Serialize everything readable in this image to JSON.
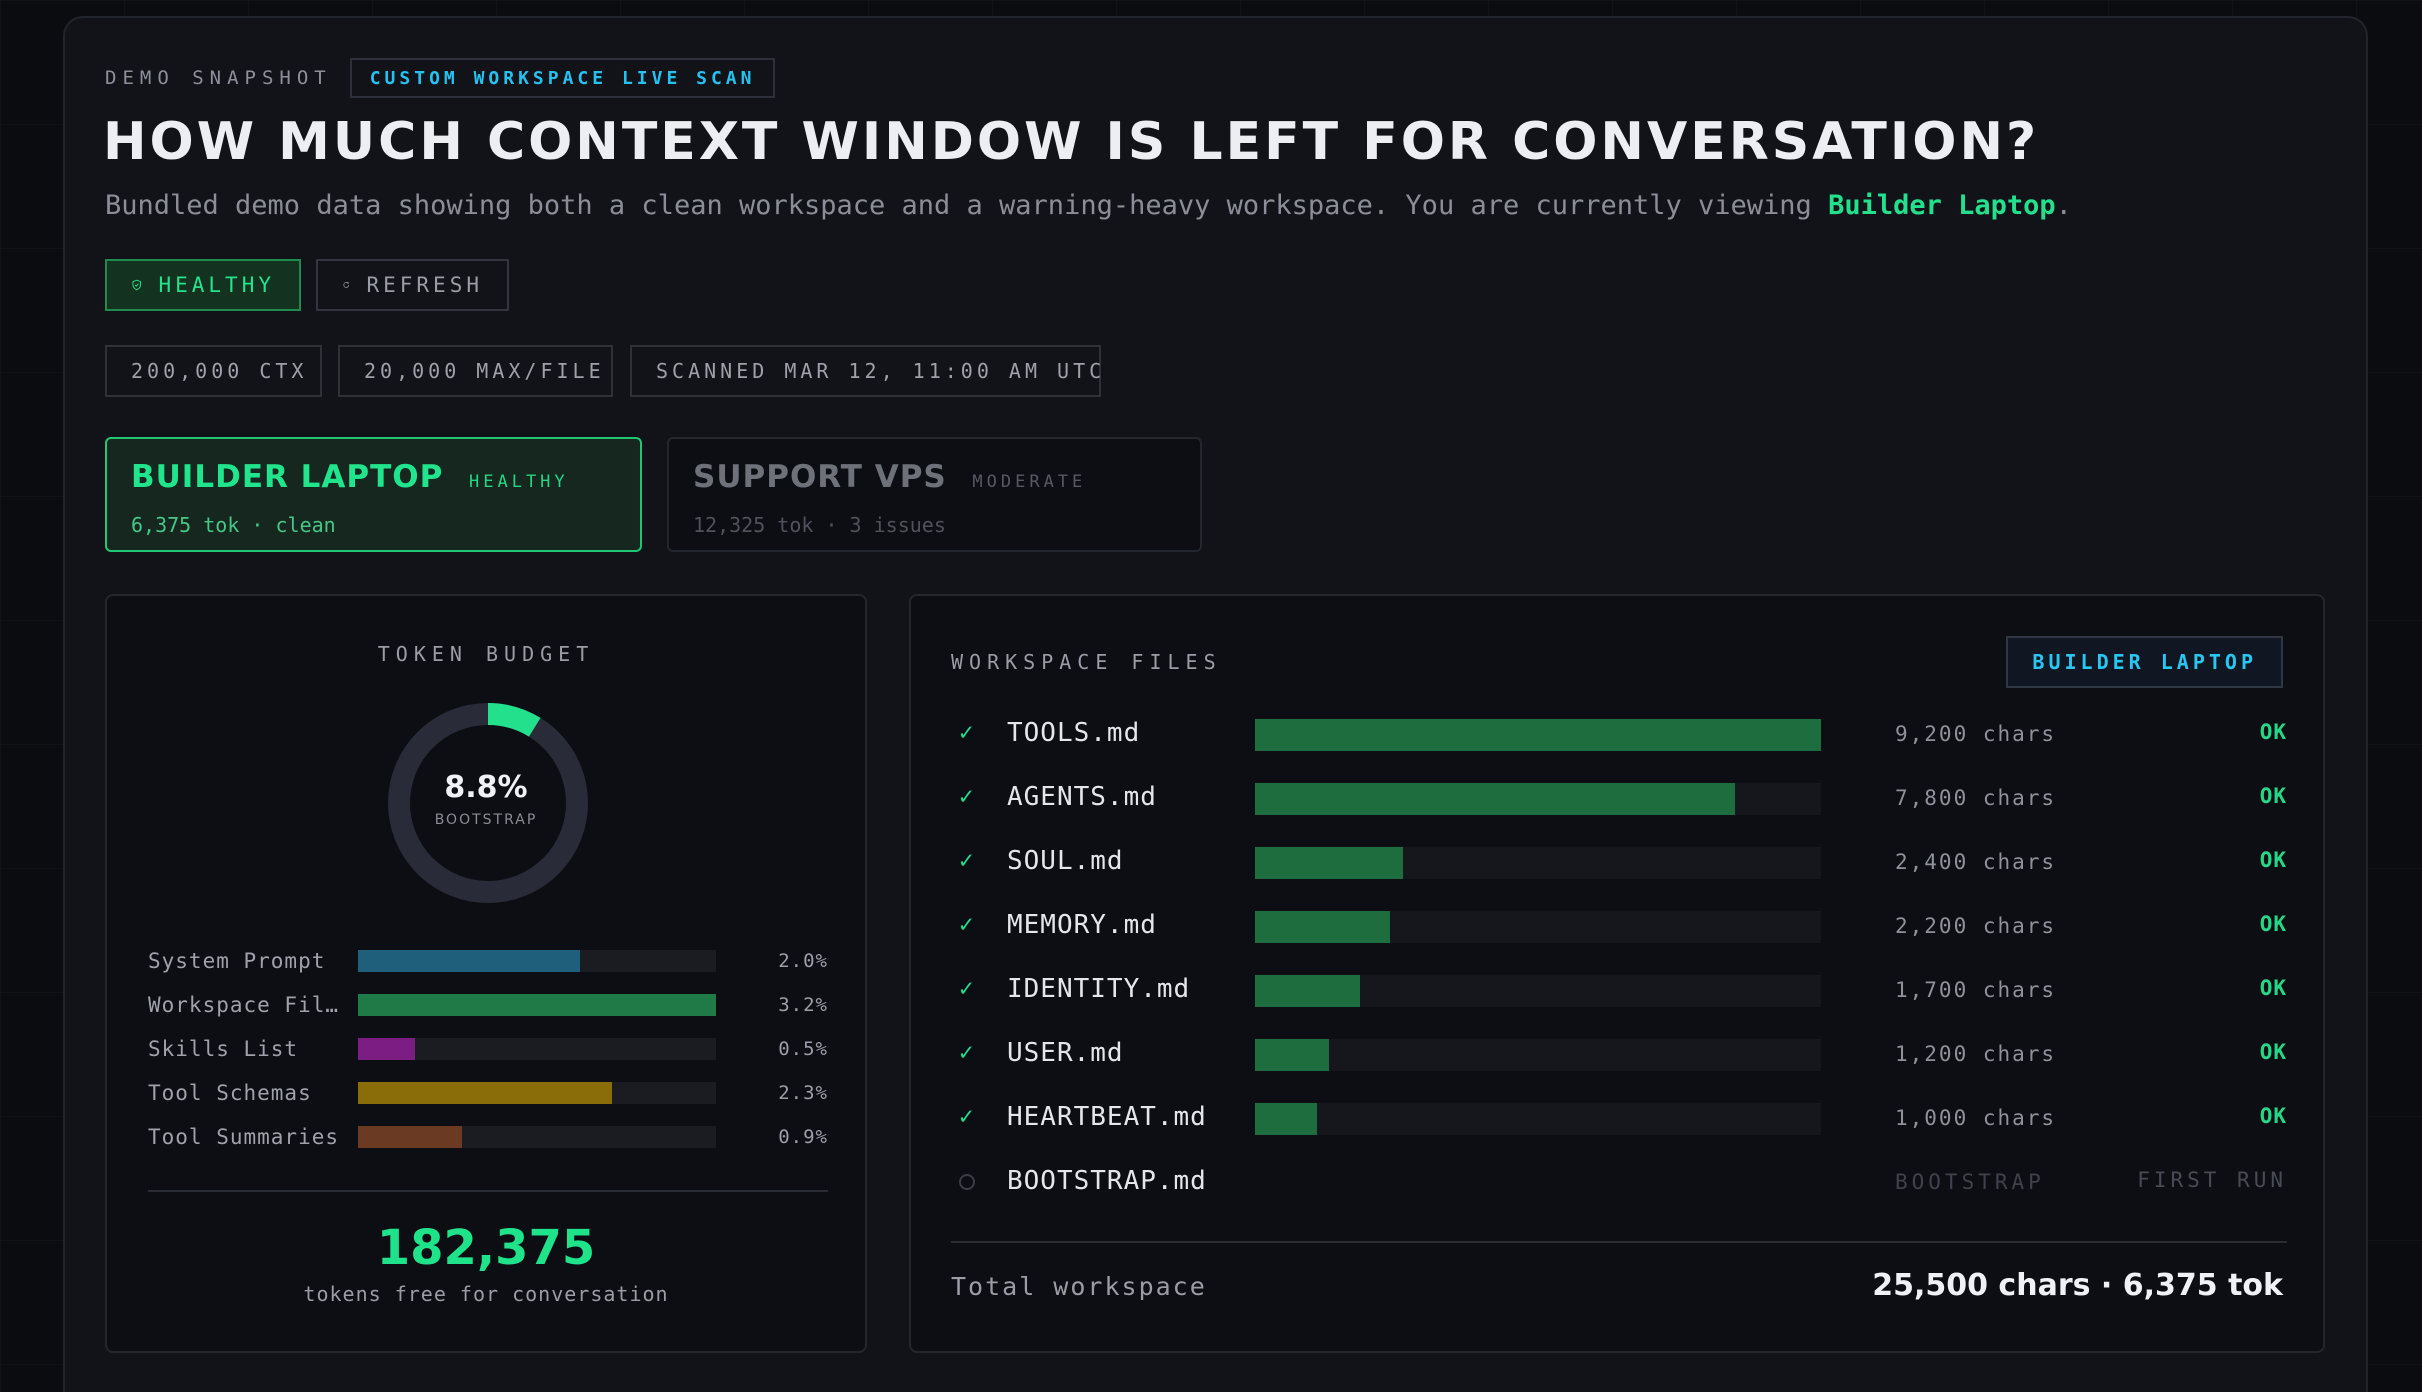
{
  "header": {
    "eyebrow": "DEMO SNAPSHOT",
    "tag": "CUSTOM WORKSPACE LIVE SCAN",
    "title": "HOW MUCH CONTEXT WINDOW IS LEFT FOR CONVERSATION?",
    "subtitle_prefix": "Bundled demo data showing both a clean workspace and a warning-heavy workspace. You are currently viewing ",
    "subtitle_workspace": "Builder Laptop",
    "subtitle_suffix": "."
  },
  "actions": {
    "healthy_label": "HEALTHY",
    "refresh_label": "REFRESH"
  },
  "meta": {
    "ctx": "200,000 CTX",
    "max_file": "20,000 MAX/FILE",
    "scanned": "SCANNED MAR 12, 11:00 AM UTC"
  },
  "workspaces": [
    {
      "name": "BUILDER LAPTOP",
      "status": "HEALTHY",
      "summary": "6,375 tok · clean",
      "selected": true
    },
    {
      "name": "SUPPORT VPS",
      "status": "MODERATE",
      "summary": "12,325 tok · 3 issues",
      "selected": false
    }
  ],
  "budget": {
    "title": "TOKEN BUDGET",
    "donut_value": "8.8%",
    "donut_percent": 8.8,
    "donut_label": "BOOTSTRAP",
    "rows": [
      {
        "label": "System Prompt",
        "pct": "2.0%",
        "fill": 0.62,
        "color": "#1f5f7c"
      },
      {
        "label": "Workspace Fil…",
        "pct": "3.2%",
        "fill": 1.0,
        "color": "#1f7a47"
      },
      {
        "label": "Skills List",
        "pct": "0.5%",
        "fill": 0.16,
        "color": "#7b1d82"
      },
      {
        "label": "Tool Schemas",
        "pct": "2.3%",
        "fill": 0.71,
        "color": "#8a6d08"
      },
      {
        "label": "Tool Summaries",
        "pct": "0.9%",
        "fill": 0.29,
        "color": "#6b3a22"
      }
    ],
    "free_tokens": "182,375",
    "free_label": "tokens free for conversation"
  },
  "files": {
    "title": "WORKSPACE FILES",
    "badge": "BUILDER LAPTOP",
    "rows": [
      {
        "name": "TOOLS.md",
        "chars": "9,200 chars",
        "status": "OK",
        "fill": 1.0,
        "checked": true
      },
      {
        "name": "AGENTS.md",
        "chars": "7,800 chars",
        "status": "OK",
        "fill": 0.848,
        "checked": true
      },
      {
        "name": "SOUL.md",
        "chars": "2,400 chars",
        "status": "OK",
        "fill": 0.261,
        "checked": true
      },
      {
        "name": "MEMORY.md",
        "chars": "2,200 chars",
        "status": "OK",
        "fill": 0.239,
        "checked": true
      },
      {
        "name": "IDENTITY.md",
        "chars": "1,700 chars",
        "status": "OK",
        "fill": 0.185,
        "checked": true
      },
      {
        "name": "USER.md",
        "chars": "1,200 chars",
        "status": "OK",
        "fill": 0.13,
        "checked": true
      },
      {
        "name": "HEARTBEAT.md",
        "chars": "1,000 chars",
        "status": "OK",
        "fill": 0.109,
        "checked": true
      },
      {
        "name": "BOOTSTRAP.md",
        "chars": "BOOTSTRAP",
        "status": "FIRST RUN",
        "fill": 0,
        "checked": false
      }
    ],
    "total_label": "Total workspace",
    "total_value": "25,500 chars · 6,375 tok"
  },
  "colors": {
    "accent_green": "#22e08c",
    "accent_cyan": "#25c1f0",
    "donut_track": "#2a2b38"
  }
}
